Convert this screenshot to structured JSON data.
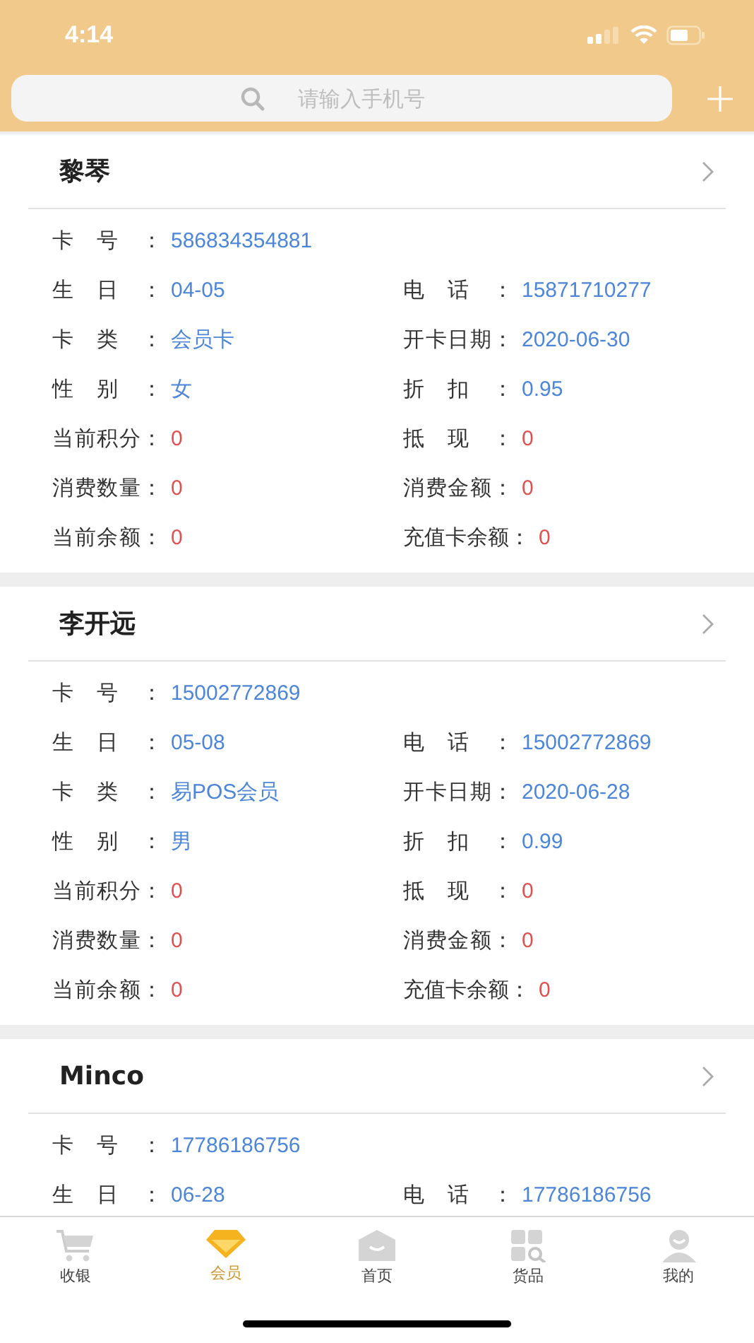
{
  "status_bar": {
    "time": "4:14"
  },
  "search": {
    "placeholder": "请输入手机号"
  },
  "members": [
    {
      "name": "黎琴",
      "rows": [
        [
          {
            "label": "卡号：",
            "value": "586834354881",
            "kind": "info"
          }
        ],
        [
          {
            "label": "生日：",
            "value": "04-05",
            "kind": "info"
          },
          {
            "label": "电话：",
            "value": "15871710277",
            "kind": "info"
          }
        ],
        [
          {
            "label": "卡类：",
            "value": "会员卡",
            "kind": "info"
          },
          {
            "label": "开卡日期：",
            "value": "2020-06-30",
            "kind": "info"
          }
        ],
        [
          {
            "label": "性别：",
            "value": "女",
            "kind": "info"
          },
          {
            "label": "折扣：",
            "value": "0.95",
            "kind": "info"
          }
        ],
        [
          {
            "label": "当前积分：",
            "value": "0",
            "kind": "amount"
          },
          {
            "label": "抵现：",
            "value": "0",
            "kind": "amount"
          }
        ],
        [
          {
            "label": "消费数量：",
            "value": "0",
            "kind": "amount"
          },
          {
            "label": "消费金额：",
            "value": "0",
            "kind": "amount"
          }
        ],
        [
          {
            "label": "当前余额：",
            "value": "0",
            "kind": "amount"
          },
          {
            "label": "充值卡余额：",
            "value": "0",
            "kind": "amount"
          }
        ]
      ]
    },
    {
      "name": "李开远",
      "rows": [
        [
          {
            "label": "卡号：",
            "value": "15002772869",
            "kind": "info"
          }
        ],
        [
          {
            "label": "生日：",
            "value": "05-08",
            "kind": "info"
          },
          {
            "label": "电话：",
            "value": "15002772869",
            "kind": "info"
          }
        ],
        [
          {
            "label": "卡类：",
            "value": "易POS会员",
            "kind": "info"
          },
          {
            "label": "开卡日期：",
            "value": "2020-06-28",
            "kind": "info"
          }
        ],
        [
          {
            "label": "性别：",
            "value": "男",
            "kind": "info"
          },
          {
            "label": "折扣：",
            "value": "0.99",
            "kind": "info"
          }
        ],
        [
          {
            "label": "当前积分：",
            "value": "0",
            "kind": "amount"
          },
          {
            "label": "抵现：",
            "value": "0",
            "kind": "amount"
          }
        ],
        [
          {
            "label": "消费数量：",
            "value": "0",
            "kind": "amount"
          },
          {
            "label": "消费金额：",
            "value": "0",
            "kind": "amount"
          }
        ],
        [
          {
            "label": "当前余额：",
            "value": "0",
            "kind": "amount"
          },
          {
            "label": "充值卡余额：",
            "value": "0",
            "kind": "amount"
          }
        ]
      ]
    },
    {
      "name": "Minco",
      "rows": [
        [
          {
            "label": "卡号：",
            "value": "17786186756",
            "kind": "info"
          }
        ],
        [
          {
            "label": "生日：",
            "value": "06-28",
            "kind": "info"
          },
          {
            "label": "电话：",
            "value": "17786186756",
            "kind": "info"
          }
        ]
      ]
    }
  ],
  "tabs": [
    {
      "label": "收银",
      "selected": false
    },
    {
      "label": "会员",
      "selected": true
    },
    {
      "label": "首页",
      "selected": false
    },
    {
      "label": "货品",
      "selected": false
    },
    {
      "label": "我的",
      "selected": false
    }
  ]
}
